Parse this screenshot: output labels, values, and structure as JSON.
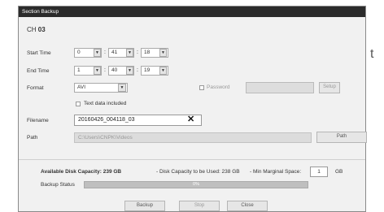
{
  "background_text": "t",
  "dialog": {
    "title": "Section Backup",
    "channel_label": "CH",
    "channel_value": "03",
    "start_time": {
      "label": "Start Time",
      "hour": "0",
      "minute": "41",
      "second": "18"
    },
    "end_time": {
      "label": "End Time",
      "hour": "1",
      "minute": "40",
      "second": "19"
    },
    "format": {
      "label": "Format",
      "value": "AVI"
    },
    "password": {
      "label": "Password",
      "value": "",
      "setup_label": "Setup"
    },
    "text_data": {
      "label": "Text data included"
    },
    "filename": {
      "label": "Filename",
      "value": "20160426_004118_03"
    },
    "path": {
      "label": "Path",
      "value": "C:\\Users\\CNPK\\Videos",
      "button_label": "Path"
    },
    "disk": {
      "available_label": "Available Disk Capacity: 239 GB",
      "to_be_used_label": "- Disk Capacity to be Used: 238 GB",
      "min_margin_label": "- Min Marginal Space:",
      "min_margin_value": "1",
      "min_margin_unit": "GB"
    },
    "backup_status": {
      "label": "Backup Status",
      "percent_text": "0%",
      "progress": 0
    },
    "buttons": {
      "backup": "Backup",
      "stop": "Stop",
      "close": "Close"
    }
  },
  "icons": {
    "spin_arrow": "▼",
    "clear": "✕"
  }
}
